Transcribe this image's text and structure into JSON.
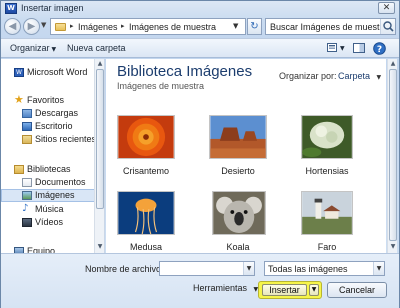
{
  "window": {
    "title": "Insertar imagen",
    "app_icon_letter": "W",
    "close_glyph": "✕"
  },
  "address": {
    "crumbs": [
      "Imágenes",
      "Imágenes de muestra"
    ],
    "separator_glyph": "▸",
    "search_text": "Buscar Imágenes de muestra"
  },
  "toolbar": {
    "organize_label": "Organizar",
    "new_folder_label": "Nueva carpeta"
  },
  "nav": {
    "items": [
      {
        "label": "Microsoft Word",
        "icon": "word-icon"
      },
      {
        "label": "Favoritos",
        "icon": "star-icon"
      },
      {
        "label": "Descargas",
        "icon": "downloads-icon"
      },
      {
        "label": "Escritorio",
        "icon": "desktop-icon"
      },
      {
        "label": "Sitios recientes",
        "icon": "recent-places-icon"
      },
      {
        "label": "Bibliotecas",
        "icon": "libraries-icon"
      },
      {
        "label": "Documentos",
        "icon": "documents-icon"
      },
      {
        "label": "Imágenes",
        "icon": "pictures-icon",
        "selected": true
      },
      {
        "label": "Música",
        "icon": "music-icon"
      },
      {
        "label": "Vídeos",
        "icon": "videos-icon"
      },
      {
        "label": "Equipo",
        "icon": "computer-icon"
      }
    ]
  },
  "content": {
    "library_title": "Biblioteca Imágenes",
    "library_subtitle": "Imágenes de muestra",
    "arrange_label": "Organizar por:",
    "arrange_value": "Carpeta",
    "images": [
      {
        "caption": "Crisantemo",
        "icon": "chrysanthemum-photo"
      },
      {
        "caption": "Desierto",
        "icon": "desert-photo"
      },
      {
        "caption": "Hortensias",
        "icon": "hydrangeas-photo"
      },
      {
        "caption": "Medusa",
        "icon": "jellyfish-photo"
      },
      {
        "caption": "Koala",
        "icon": "koala-photo"
      },
      {
        "caption": "Faro",
        "icon": "lighthouse-photo"
      }
    ]
  },
  "bottom": {
    "filename_label": "Nombre de archivo:",
    "filename_value": "",
    "filter_value": "Todas las imágenes",
    "tools_label": "Herramientas",
    "insert_label": "Insertar",
    "cancel_label": "Cancelar"
  },
  "colors": {
    "insert_highlight": "#f6f54a",
    "library_title": "#1c3d6e",
    "selection": "#d9e6f6"
  }
}
